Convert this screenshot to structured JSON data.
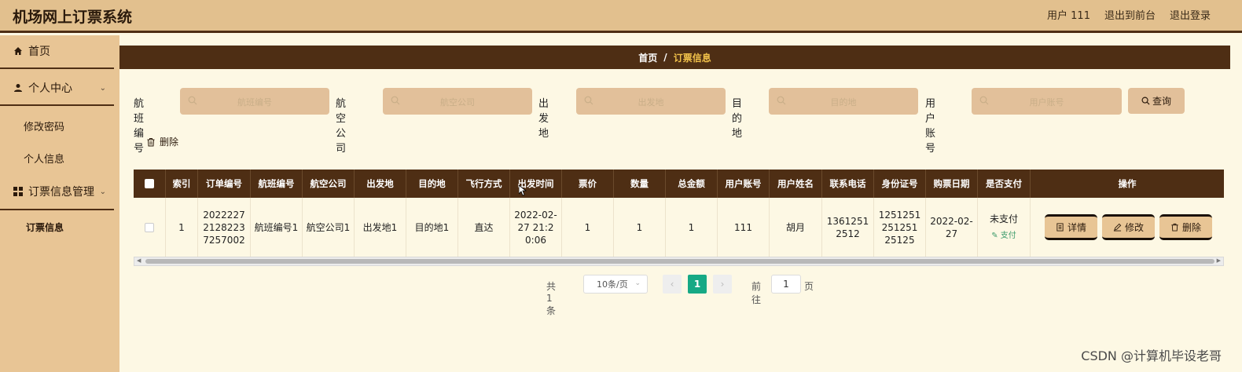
{
  "app": {
    "title": "机场网上订票系统"
  },
  "topnav": {
    "user": "用户 111",
    "front": "退出到前台",
    "logout": "退出登录"
  },
  "sidebar": {
    "home": "首页",
    "personal": "个人中心",
    "change_password": "修改密码",
    "personal_info": "个人信息",
    "ticket_mgmt": "订票信息管理",
    "ticket_info": "订票信息"
  },
  "breadcrumb": {
    "home": "首页",
    "sep": "/",
    "current": "订票信息"
  },
  "search": {
    "flight_no": {
      "label": "航班编号",
      "placeholder": "航班编号"
    },
    "airline": {
      "label": "航空公司",
      "placeholder": "航空公司"
    },
    "origin": {
      "label": "出发地",
      "placeholder": "出发地"
    },
    "destination": {
      "label": "目的地",
      "placeholder": "目的地"
    },
    "account": {
      "label": "用户账号",
      "placeholder": "用户账号"
    },
    "query_label": "查询"
  },
  "toolbar": {
    "delete_label": "删除"
  },
  "table": {
    "headers": [
      "索引",
      "订单编号",
      "航班编号",
      "航空公司",
      "出发地",
      "目的地",
      "飞行方式",
      "出发时间",
      "票价",
      "数量",
      "总金额",
      "用户账号",
      "用户姓名",
      "联系电话",
      "身份证号",
      "购票日期",
      "是否支付",
      "操作"
    ],
    "rows": [
      {
        "index": "1",
        "order_no": "20222272128223 7257002",
        "flight_no": "航班编号1",
        "airline": "航空公司1",
        "origin": "出发地1",
        "destination": "目的地1",
        "flight_mode": "直达",
        "depart_time": "2022-02-27 21:20:06",
        "price": "1",
        "qty": "1",
        "total": "1",
        "account": "111",
        "name": "胡月",
        "phone": "13612512512",
        "id_card": "1251251251251 25125",
        "buy_date": "2022-02-27",
        "paid": "未支付",
        "pay_link": "支付"
      }
    ],
    "actions": {
      "detail": "详情",
      "edit": "修改",
      "delete": "删除"
    }
  },
  "pagination": {
    "total": "共 1 条",
    "page_size": "10条/页",
    "current": "1",
    "goto_label": "前往",
    "goto_value": "1",
    "page_label": "页"
  },
  "watermark": "CSDN @计算机毕设老哥"
}
